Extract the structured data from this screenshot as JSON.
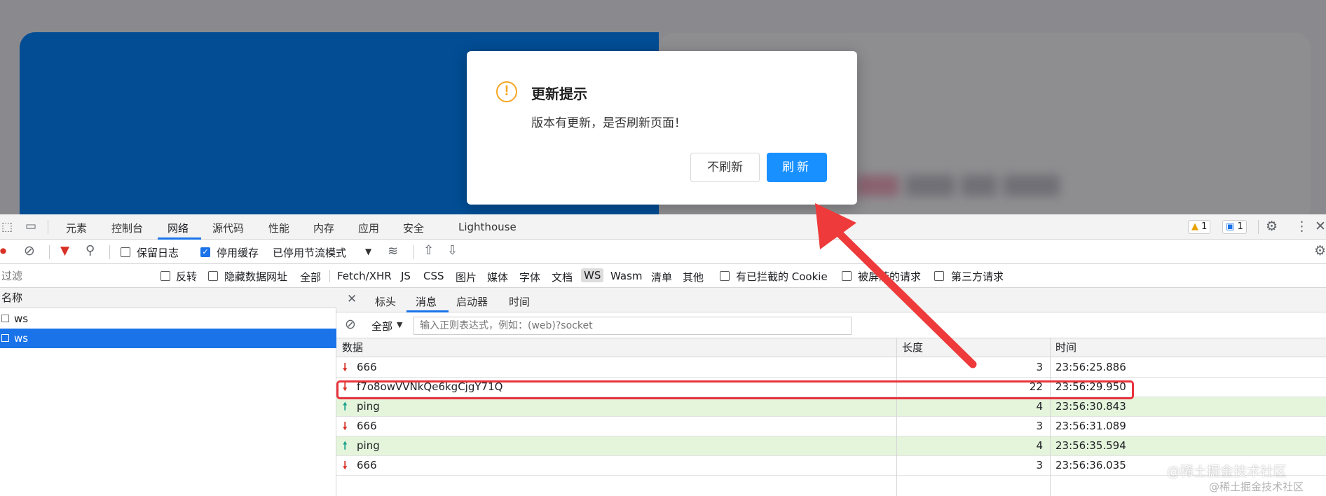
{
  "modal": {
    "title": "更新提示",
    "content": "版本有更新，是否刷新页面！",
    "cancel_label": "不刷新",
    "ok_label": "刷新",
    "icon": "warning-icon",
    "accent_color": "#1890ff"
  },
  "page": {
    "avatar_glyph": "“"
  },
  "devtools": {
    "tabs": [
      "元素",
      "控制台",
      "网络",
      "源代码",
      "性能",
      "内存",
      "应用",
      "安全",
      "Lighthouse"
    ],
    "active_tab": "网络",
    "warnings_count": "1",
    "messages_count": "1",
    "toolbar": {
      "preserve_log": "保留日志",
      "disable_cache": "停用缓存",
      "throttling": "已停用节流模式"
    },
    "filter": {
      "placeholder": "过滤",
      "invert": "反转",
      "hide_data_urls": "隐藏数据网址",
      "all": "全部",
      "types": [
        "Fetch/XHR",
        "JS",
        "CSS",
        "图片",
        "媒体",
        "字体",
        "文档",
        "WS",
        "Wasm",
        "清单",
        "其他"
      ],
      "active_type": "WS",
      "blocked_cookies": "有已拦截的 Cookie",
      "blocked_requests": "被屏蔽的请求",
      "third_party": "第三方请求"
    },
    "requests": {
      "header": "名称",
      "items": [
        "ws",
        "ws"
      ]
    },
    "detail": {
      "tabs": [
        "标头",
        "消息",
        "启动器",
        "时间"
      ],
      "active_tab": "消息",
      "filter_all": "全部",
      "filter_placeholder": "输入正则表达式，例如：(web)?socket",
      "columns": [
        "数据",
        "长度",
        "时间"
      ],
      "messages": [
        {
          "dir": "received",
          "arrow": "🠗",
          "data": "666",
          "length": "3",
          "time": "23:56:25.886"
        },
        {
          "dir": "received",
          "arrow": "🠗",
          "data": "f7o8owVVNkQe6kgCjgY71Q",
          "length": "22",
          "time": "23:56:29.950"
        },
        {
          "dir": "sent",
          "arrow": "🠕",
          "data": "ping",
          "length": "4",
          "time": "23:56:30.843"
        },
        {
          "dir": "received",
          "arrow": "🠗",
          "data": "666",
          "length": "3",
          "time": "23:56:31.089"
        },
        {
          "dir": "sent",
          "arrow": "🠕",
          "data": "ping",
          "length": "4",
          "time": "23:56:35.594"
        },
        {
          "dir": "received",
          "arrow": "🠗",
          "data": "666",
          "length": "3",
          "time": "23:56:36.035"
        }
      ]
    }
  },
  "watermark": {
    "primary": "@稀土掘金技术社区",
    "secondary": "@稀土掘金技术社区"
  }
}
